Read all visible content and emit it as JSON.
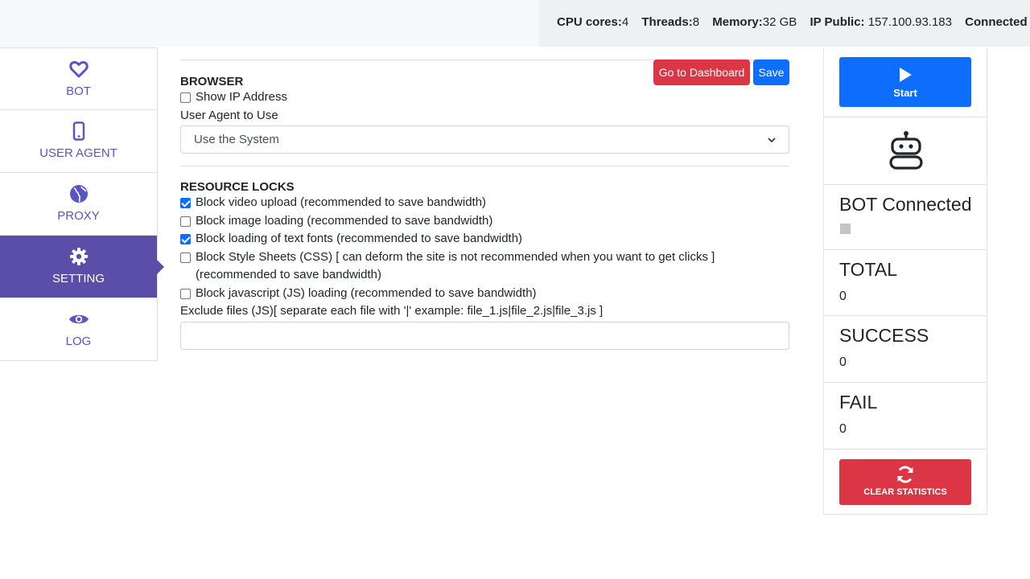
{
  "header": {
    "cpu_label": "CPU cores:",
    "cpu_value": "4",
    "threads_label": "Threads:",
    "threads_value": "8",
    "memory_label": "Memory:",
    "memory_value": "32 GB",
    "ip_label": "IP Public:",
    "ip_value": "157.100.93.183",
    "connected_label": "Connected Al"
  },
  "sidebar": {
    "items": [
      {
        "label": "BOT",
        "icon": "heart-icon"
      },
      {
        "label": "USER AGENT",
        "icon": "mobile-icon"
      },
      {
        "label": "PROXY",
        "icon": "globe-icon"
      },
      {
        "label": "SETTING",
        "icon": "gear-icon",
        "active": true
      },
      {
        "label": "LOG",
        "icon": "eye-icon"
      }
    ]
  },
  "actions": {
    "dashboard_label": "Go to Dashboard",
    "save_label": "Save"
  },
  "browser": {
    "title": "BROWSER",
    "show_ip_label": "Show IP Address",
    "show_ip_checked": false,
    "user_agent_label": "User Agent to Use",
    "user_agent_value": "Use the System"
  },
  "resource_locks": {
    "title": "RESOURCE LOCKS",
    "items": [
      {
        "label": "Block video upload (recommended to save bandwidth)",
        "checked": true
      },
      {
        "label": "Block image loading (recommended to save bandwidth)",
        "checked": false
      },
      {
        "label": "Block loading of text fonts (recommended to save bandwidth)",
        "checked": true
      },
      {
        "label": "Block Style Sheets (CSS) [ can deform the site is not recommended when you want to get clicks ] (recommended to save bandwidth)",
        "checked": false
      },
      {
        "label": "Block javascript (JS) loading (recommended to save bandwidth)",
        "checked": false
      }
    ],
    "exclude_label": "Exclude files (JS)[ separate each file with '|' example: file_1.js|file_2.js|file_3.js ]",
    "exclude_value": ""
  },
  "panel": {
    "start_label": "Start",
    "status_title": "BOT Connected",
    "status_color": "#c4c4c4",
    "total_label": "TOTAL",
    "total_value": "0",
    "success_label": "SUCCESS",
    "success_value": "0",
    "fail_label": "FAIL",
    "fail_value": "0",
    "clear_label": "CLEAR STATISTICS"
  },
  "colors": {
    "accent": "#5b4ea8",
    "primary": "#0d6efd",
    "danger": "#dc3545"
  }
}
